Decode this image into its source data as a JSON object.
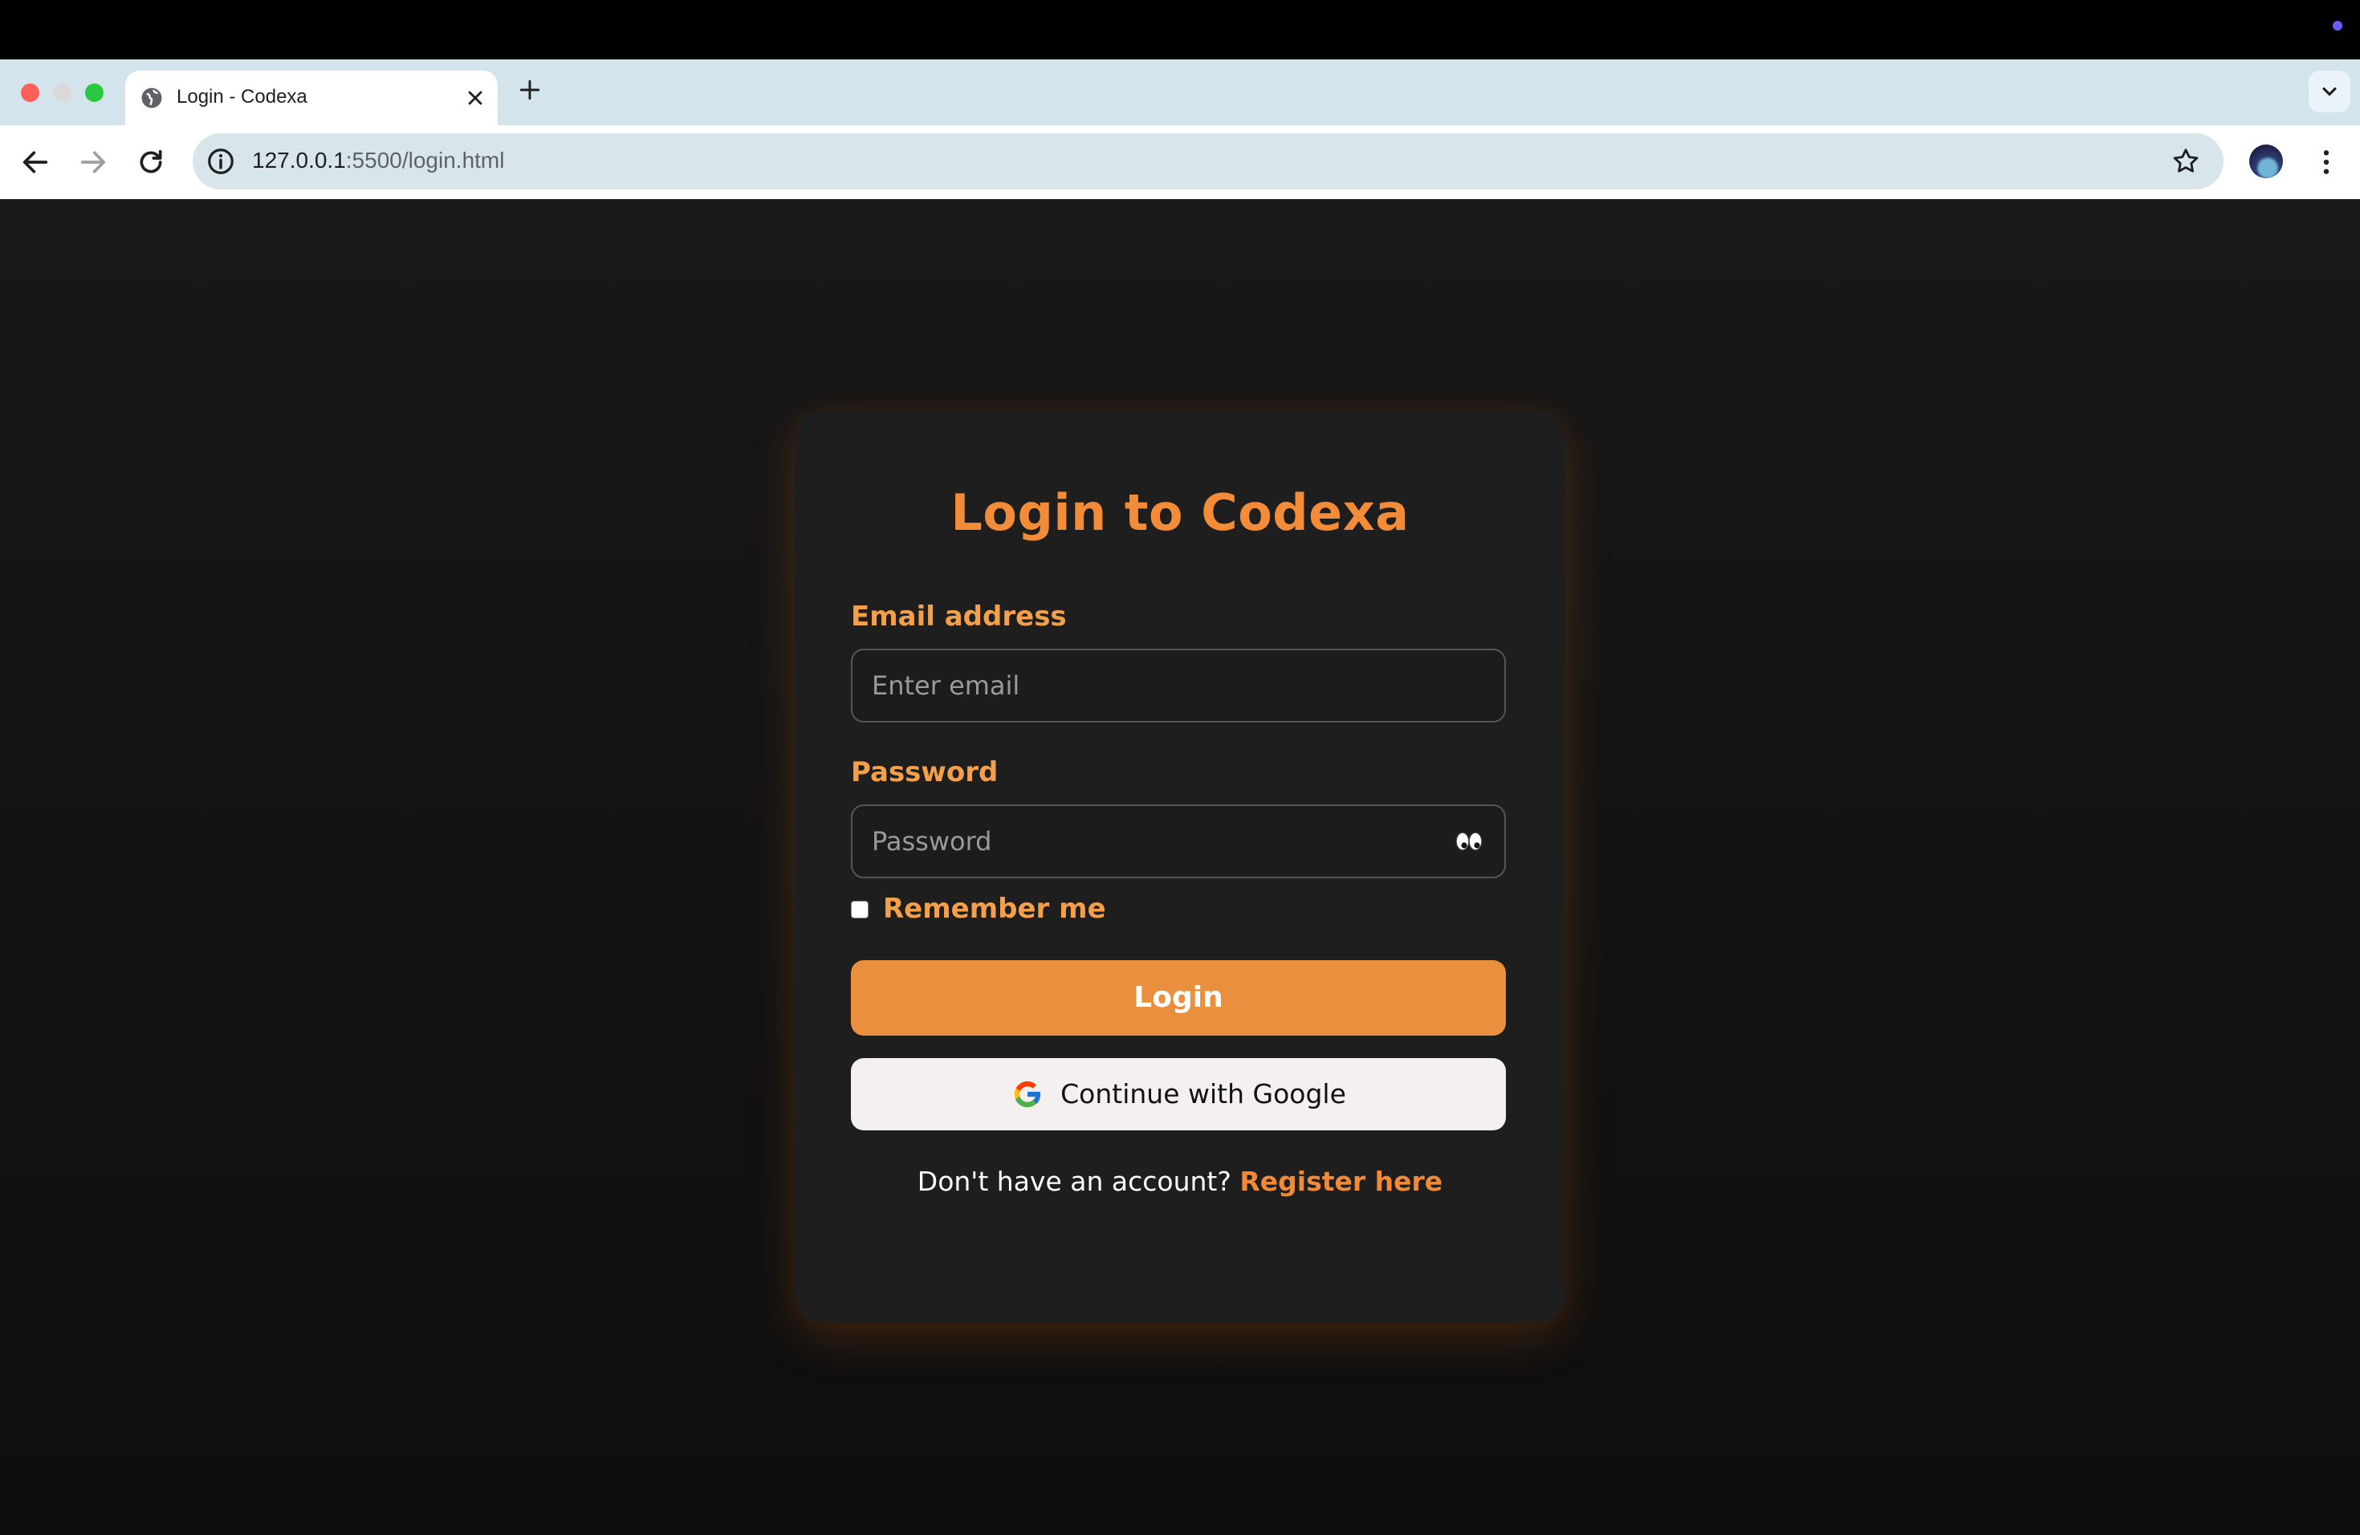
{
  "browser": {
    "tab_title": "Login - Codexa",
    "url_host": "127.0.0.1",
    "url_rest": ":5500/login.html",
    "icons": {
      "tab_favicon": "globe-icon",
      "tab_close": "close-icon",
      "new_tab": "plus-icon",
      "tab_search": "chevron-down-icon",
      "back": "back-arrow-icon",
      "forward": "forward-arrow-icon",
      "reload": "reload-icon",
      "site_info": "info-icon",
      "bookmark": "star-icon",
      "menu": "kebab-menu-icon"
    }
  },
  "page": {
    "title": "Login to Codexa",
    "email_label": "Email address",
    "email_placeholder": "Enter email",
    "password_label": "Password",
    "password_placeholder": "Password",
    "password_toggle_icon": "eyes-icon",
    "remember_label": "Remember me",
    "remember_checked": false,
    "login_button": "Login",
    "google_button": "Continue with Google",
    "register_prompt": "Don't have an account?",
    "register_link": "Register here"
  },
  "colors": {
    "accent": "#f28c38",
    "label": "#f4a04a",
    "button": "#e98f3e",
    "card": "#1e1e1e",
    "background": "#121212"
  }
}
